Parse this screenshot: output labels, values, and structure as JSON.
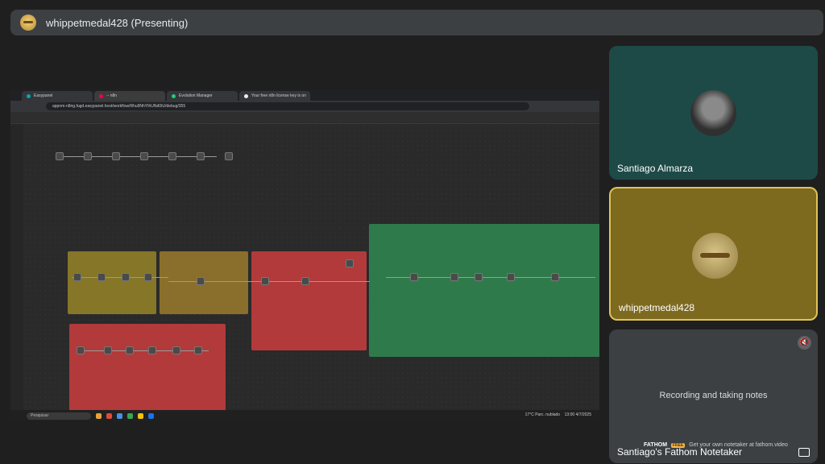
{
  "meeting": {
    "presenter_title": "whippetmedal428 (Presenting)"
  },
  "browser": {
    "tabs": [
      "Easypanel",
      "-- n8n",
      "Evolution Manager",
      "Your free n8n license key is on"
    ],
    "url": "appnm-n8ng.fugd.easypanel.host/workflow/Rhu9NhYIhUNd0tU/debug/355"
  },
  "taskbar": {
    "search_label": "Pesquisar",
    "weather": "17°C Parc. nublado",
    "time": "13:00",
    "date": "4/7/2025"
  },
  "participants": [
    {
      "name": "Santiago Almarza",
      "avatar": "photo"
    },
    {
      "name": "whippetmedal428",
      "avatar": "photo"
    },
    {
      "name": "Santiago's Fathom Notetaker",
      "status": "Recording and taking notes"
    }
  ],
  "fathom": {
    "brand": "FATHOM",
    "badge": "FREE",
    "tagline": "Get your own notetaker at fathom.video"
  },
  "icons": {
    "mic": "mic-off-icon",
    "expand": "expand-icon"
  }
}
